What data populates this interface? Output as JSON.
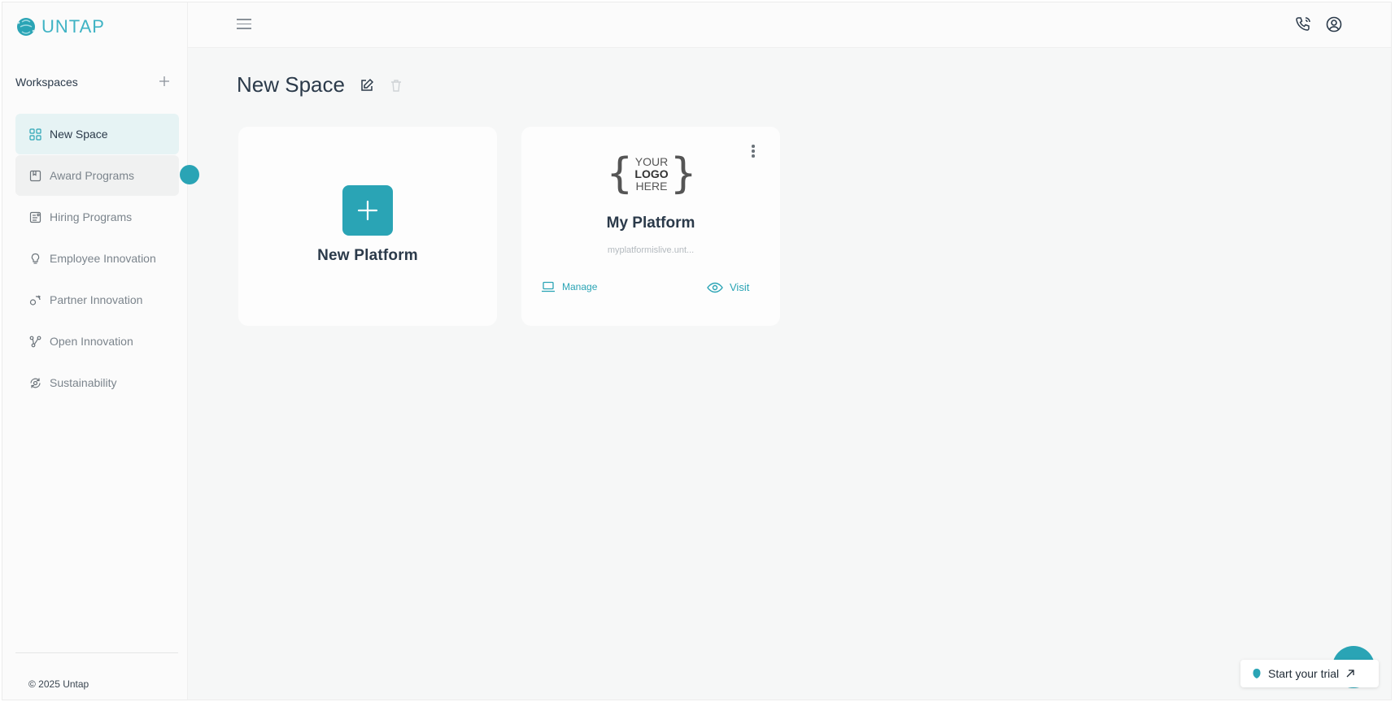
{
  "brand": {
    "name": "UNTAP",
    "accent": "#2aa4b5"
  },
  "sidebar": {
    "workspaces_title": "Workspaces",
    "add_icon": "plus-icon",
    "items": [
      {
        "label": "New Space",
        "icon": "grid-icon",
        "active": true
      },
      {
        "label": "Award Programs",
        "icon": "bookmark-icon"
      },
      {
        "label": "Hiring Programs",
        "icon": "document-icon"
      },
      {
        "label": "Employee Innovation",
        "icon": "lightbulb-icon"
      },
      {
        "label": "Partner Innovation",
        "icon": "handshake-icon"
      },
      {
        "label": "Open Innovation",
        "icon": "nodes-icon"
      },
      {
        "label": "Sustainability",
        "icon": "recycle-icon"
      }
    ],
    "copyright": "© 2025 Untap"
  },
  "topbar": {
    "icons": [
      "menu-icon",
      "phone-icon",
      "user-circle-icon"
    ]
  },
  "main": {
    "title": "New Space",
    "new_card": {
      "label": "New Platform"
    },
    "platform_card": {
      "logo_words": [
        "YOUR",
        "LOGO",
        "HERE"
      ],
      "name": "My Platform",
      "url": "myplatformislive.unt...",
      "manage_label": "Manage",
      "visit_label": "Visit"
    }
  },
  "trial": {
    "label": "Start your trial"
  }
}
